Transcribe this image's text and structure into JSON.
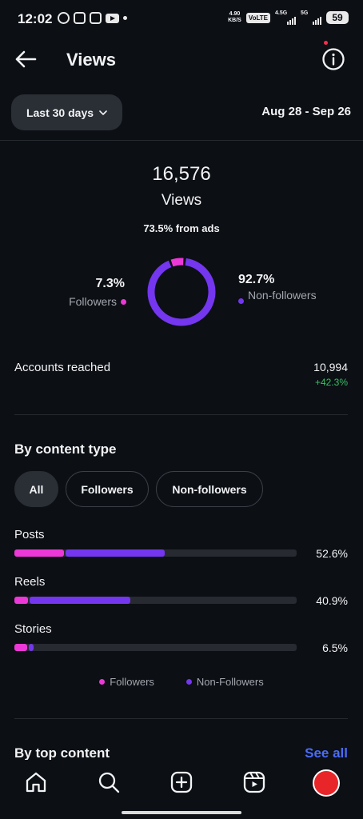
{
  "status_bar": {
    "time": "12:02",
    "speed_value": "4.90",
    "speed_unit": "KB/S",
    "volte": "VoLTE",
    "network_1": "4.5G",
    "network_2": "5G",
    "battery": "59"
  },
  "header": {
    "title": "Views",
    "back_icon": "arrow-left-icon",
    "info_icon": "info-icon"
  },
  "filter": {
    "range_label": "Last 30 days",
    "date_range": "Aug 28 - Sep 26"
  },
  "summary": {
    "views_count": "16,576",
    "views_label": "Views",
    "ads_text": "73.5% from ads",
    "followers_pct": "7.3%",
    "followers_label": "Followers",
    "non_followers_pct": "92.7%",
    "non_followers_label": "Non-followers",
    "followers_fraction": 0.073,
    "non_followers_fraction": 0.927
  },
  "accounts_reached": {
    "label": "Accounts reached",
    "value": "10,994",
    "change": "+42.3%"
  },
  "content_type": {
    "title": "By content type",
    "chips": [
      "All",
      "Followers",
      "Non-followers"
    ],
    "active_chip": "All",
    "rows": [
      {
        "label": "Posts",
        "pct": "52.6%",
        "followers_share": 0.175,
        "non_followers_share": 0.357
      },
      {
        "label": "Reels",
        "pct": "40.9%",
        "followers_share": 0.047,
        "non_followers_share": 0.363
      },
      {
        "label": "Stories",
        "pct": "6.5%",
        "followers_share": 0.045,
        "non_followers_share": 0.022
      }
    ],
    "legend": {
      "followers": "Followers",
      "non_followers": "Non-Followers"
    }
  },
  "top_content": {
    "title": "By top content",
    "see_all": "See all"
  },
  "colors": {
    "followers": "#ec38d7",
    "non_followers": "#7436ef",
    "positive": "#35c265",
    "link": "#4a6cf7"
  },
  "nav": {
    "items": [
      "home-icon",
      "search-icon",
      "create-icon",
      "reels-icon",
      "profile-avatar"
    ]
  }
}
